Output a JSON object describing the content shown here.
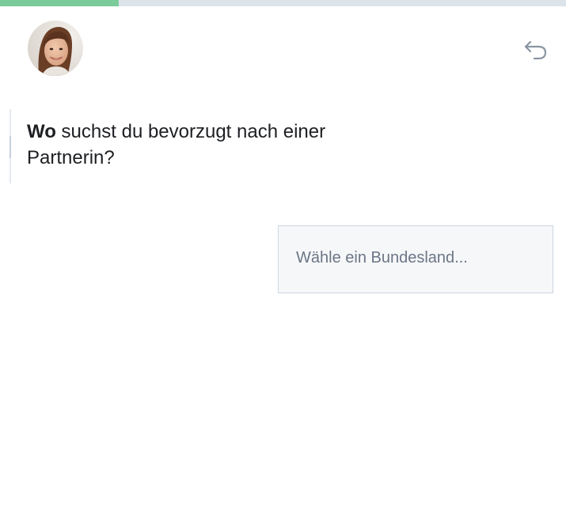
{
  "progress": {
    "fraction": 0.21,
    "fill_color": "#7ccb9a",
    "track_color": "#dde3ea"
  },
  "avatar": {
    "icon": "woman-portrait-avatar"
  },
  "back_button": {
    "icon": "undo-arrow-icon"
  },
  "question": {
    "bold": "Wo",
    "text": " suchst du bevorzugt nach einer Partnerin?"
  },
  "state_select": {
    "placeholder": "Wähle ein Bundesland..."
  }
}
